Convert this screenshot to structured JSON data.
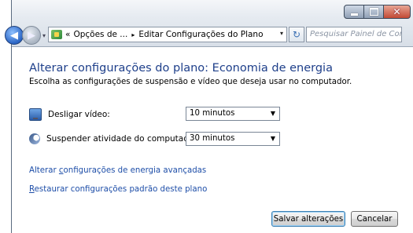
{
  "window": {
    "controls": {
      "minimize_icon": "minimize-icon",
      "maximize_icon": "maximize-icon",
      "close_icon": "close-icon"
    }
  },
  "navigation": {
    "back_icon": "back-arrow-icon",
    "forward_icon": "forward-arrow-icon",
    "overflow": "«",
    "breadcrumb": [
      {
        "label": "Opções de ..."
      },
      {
        "label": "Editar Configurações do Plano"
      }
    ],
    "separator": "▸",
    "search_placeholder": "Pesquisar Painel de Controle"
  },
  "page": {
    "title": "Alterar configurações do plano: Economia de energia",
    "subtitle": "Escolha as configurações de suspensão e vídeo que deseja usar no computador."
  },
  "settings": [
    {
      "label": "Desligar vídeo:",
      "icon": "monitor-icon",
      "value": "10 minutos"
    },
    {
      "label": "Suspender atividade do computador:",
      "icon": "sleep-moon-icon",
      "value": "30 minutos"
    }
  ],
  "links": {
    "advanced": {
      "prefix": "Alterar ",
      "accel": "c",
      "rest": "onfigurações de energia avançadas"
    },
    "restore": {
      "prefix": "",
      "accel": "R",
      "rest": "estaurar configurações padrão deste plano"
    }
  },
  "buttons": {
    "save": "Salvar alterações",
    "cancel": "Cancelar"
  },
  "colors": {
    "title": "#1e3f8a",
    "link": "#1e4ea8",
    "close_button": "#c24a35"
  }
}
